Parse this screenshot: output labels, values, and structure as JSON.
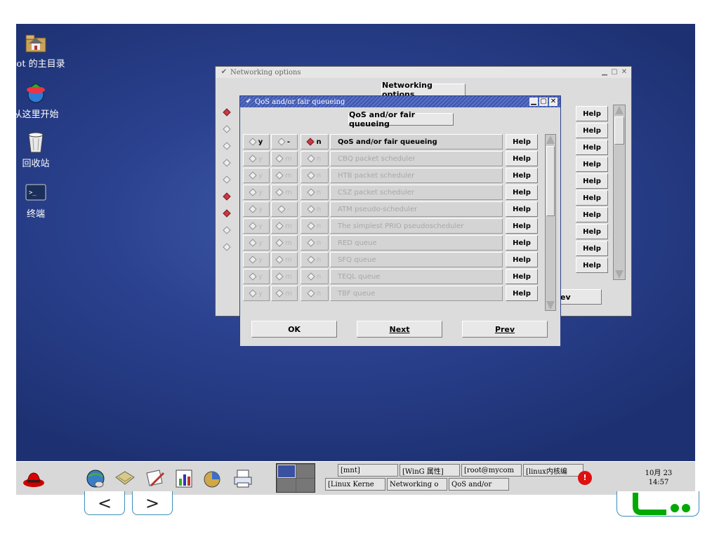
{
  "desktop": {
    "icons": [
      {
        "label": "root 的主目录",
        "icon": "home-folder-icon"
      },
      {
        "label": "从这里开始",
        "icon": "start-here-icon"
      },
      {
        "label": "回收站",
        "icon": "trash-icon"
      },
      {
        "label": "终端",
        "icon": "terminal-icon"
      }
    ]
  },
  "networking_window": {
    "title": "Networking options",
    "heading": "Networking options",
    "help_label": "Help",
    "bottom_button_partial": "ev"
  },
  "qos_dialog": {
    "title": "QoS and/or fair queueing",
    "heading": "QoS and/or fair queueing",
    "help_label": "Help",
    "rows": [
      {
        "y": "y",
        "m": "-",
        "n": "n",
        "label": "QoS and/or fair queueing",
        "enabled": true,
        "selected": "n"
      },
      {
        "y": "y",
        "m": "m",
        "n": "n",
        "label": "CBQ packet scheduler",
        "enabled": false,
        "selected": "none"
      },
      {
        "y": "y",
        "m": "m",
        "n": "n",
        "label": "HTB packet scheduler",
        "enabled": false,
        "selected": "none"
      },
      {
        "y": "y",
        "m": "m",
        "n": "n",
        "label": "CSZ packet scheduler",
        "enabled": false,
        "selected": "none"
      },
      {
        "y": "y",
        "m": "-",
        "n": "n",
        "label": "ATM pseudo-scheduler",
        "enabled": false,
        "selected": "none"
      },
      {
        "y": "y",
        "m": "m",
        "n": "n",
        "label": "The simplest PRIO pseudoscheduler",
        "enabled": false,
        "selected": "none"
      },
      {
        "y": "y",
        "m": "m",
        "n": "n",
        "label": "RED queue",
        "enabled": false,
        "selected": "none"
      },
      {
        "y": "y",
        "m": "m",
        "n": "n",
        "label": "SFQ queue",
        "enabled": false,
        "selected": "none"
      },
      {
        "y": "y",
        "m": "m",
        "n": "n",
        "label": "TEQL queue",
        "enabled": false,
        "selected": "none"
      },
      {
        "y": "y",
        "m": "m",
        "n": "n",
        "label": "TBF queue",
        "enabled": false,
        "selected": "none"
      }
    ],
    "buttons": {
      "ok": "OK",
      "next": "Next",
      "prev": "Prev"
    }
  },
  "taskbar": {
    "tasks_row1": [
      "[mnt]",
      "[WinG 属性]",
      "[root@mycom",
      "[linux内核编"
    ],
    "tasks_row2": [
      "[Linux Kerne",
      "Networking o",
      "QoS and/or"
    ],
    "clock": {
      "date": "10月 23",
      "time": "14:57"
    }
  },
  "nav": {
    "back": "<",
    "forward": ">"
  },
  "colors": {
    "desktop": "#2b4290",
    "selected_radio": "#c83a44",
    "title_bar": "#3a50a0"
  }
}
